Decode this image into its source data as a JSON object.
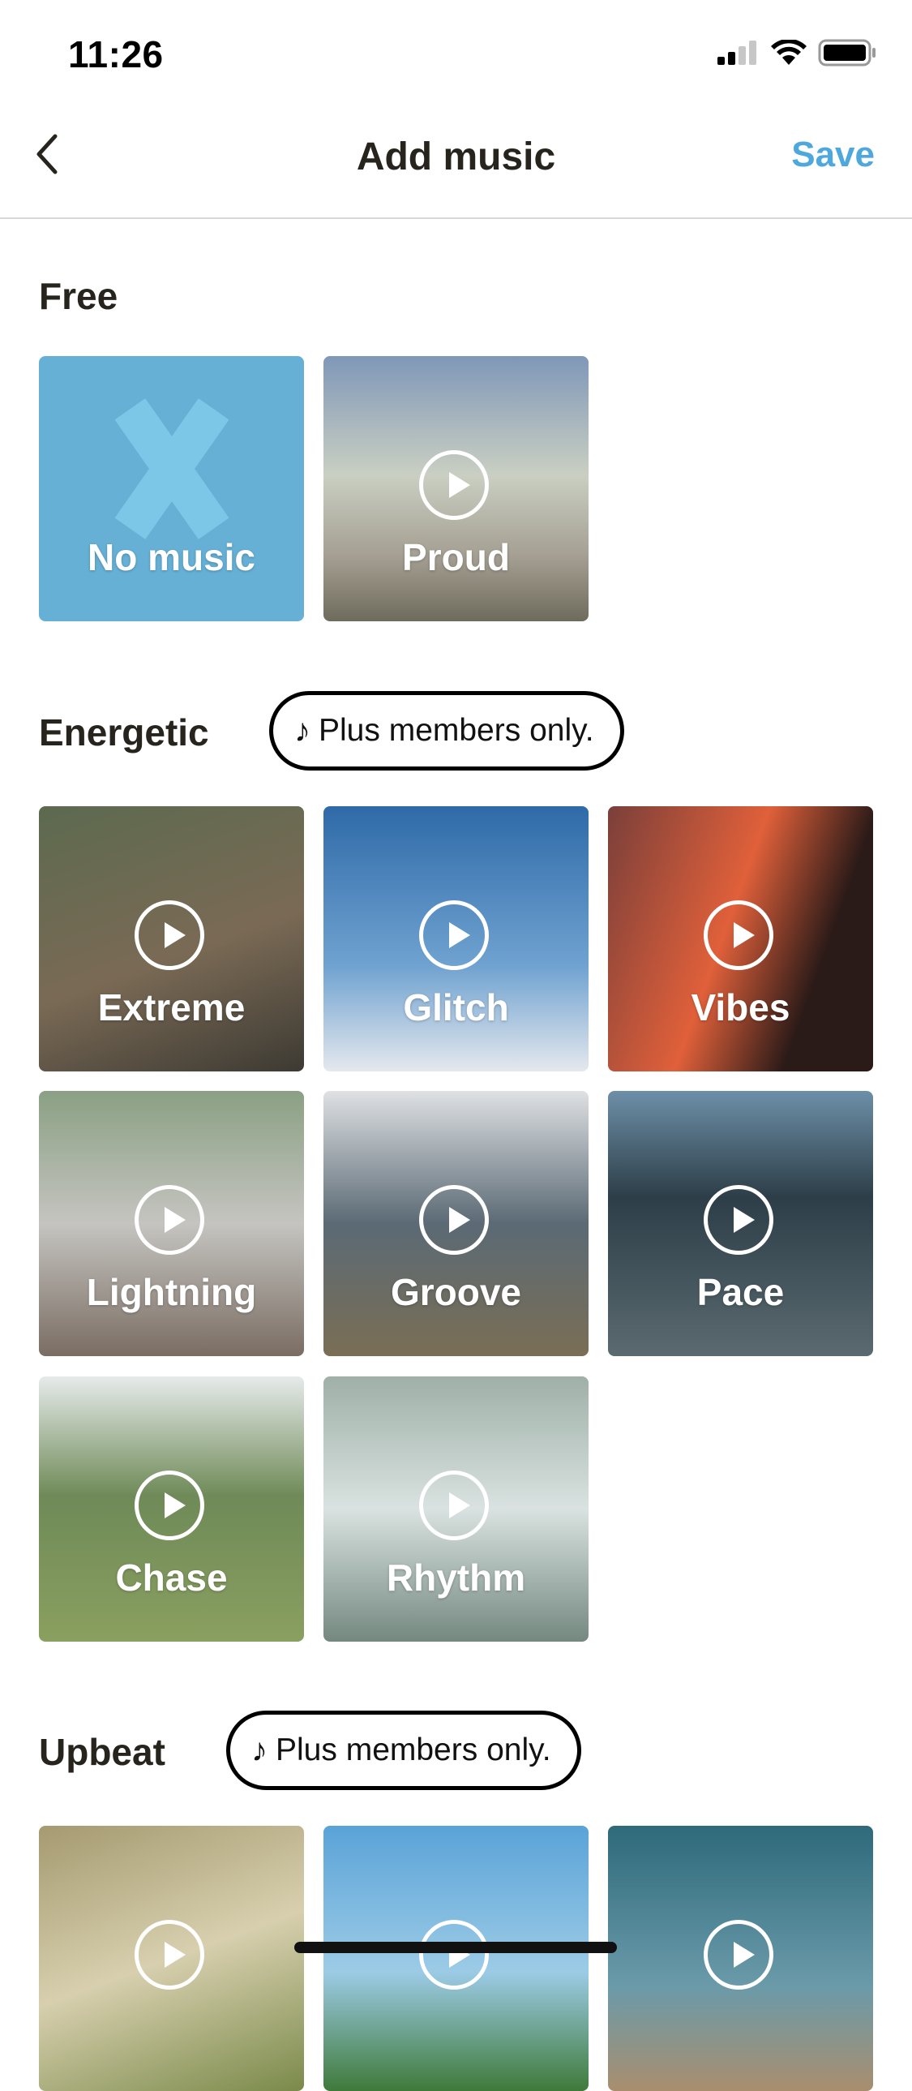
{
  "status_bar": {
    "time": "11:26"
  },
  "nav": {
    "title": "Add music",
    "save_label": "Save",
    "back_label": "Back"
  },
  "sections": [
    {
      "title": "Free",
      "badge": null,
      "tracks": [
        {
          "name": "No music",
          "type": "none",
          "color": "#66b0d6"
        },
        {
          "name": "Proud",
          "type": "track",
          "colors": [
            "#7f97b8",
            "#c9cfc2",
            "#6f6b5c"
          ]
        }
      ]
    },
    {
      "title": "Energetic",
      "badge": {
        "icon": "♪",
        "text": "Plus members only."
      },
      "tracks": [
        {
          "name": "Extreme",
          "colors": [
            "#5c6a4f",
            "#7a6a55",
            "#3d3a33"
          ]
        },
        {
          "name": "Glitch",
          "colors": [
            "#2f6aa8",
            "#6fa2d0",
            "#e5e8ee"
          ]
        },
        {
          "name": "Vibes",
          "colors": [
            "#7a3f3a",
            "#e0603a",
            "#2a1a18"
          ]
        },
        {
          "name": "Lightning",
          "colors": [
            "#8aa083",
            "#c5c4c0",
            "#7a6d63"
          ]
        },
        {
          "name": "Groove",
          "colors": [
            "#dfe1e3",
            "#5b6a75",
            "#7a6e55"
          ]
        },
        {
          "name": "Pace",
          "colors": [
            "#6d8fa8",
            "#2d3e48",
            "#5b6a70"
          ]
        },
        {
          "name": "Chase",
          "colors": [
            "#e6ebea",
            "#6f8a58",
            "#8aa060"
          ]
        },
        {
          "name": "Rhythm",
          "colors": [
            "#9fb0a8",
            "#d9e2e0",
            "#748880"
          ]
        }
      ]
    },
    {
      "title": "Upbeat",
      "badge": {
        "icon": "♪",
        "text": "Plus members only."
      },
      "tracks": [
        {
          "name": "",
          "colors": [
            "#a59a70",
            "#d7cfae",
            "#7a8a4a"
          ]
        },
        {
          "name": "",
          "colors": [
            "#5aa3d8",
            "#9ccbe6",
            "#3f7a3a"
          ]
        },
        {
          "name": "",
          "colors": [
            "#2e6a7a",
            "#6a9aaa",
            "#a98e6e"
          ]
        }
      ]
    }
  ],
  "colors": {
    "accent": "#4ea8de",
    "no_music_bg": "#66b0d6",
    "text": "#26241c"
  }
}
